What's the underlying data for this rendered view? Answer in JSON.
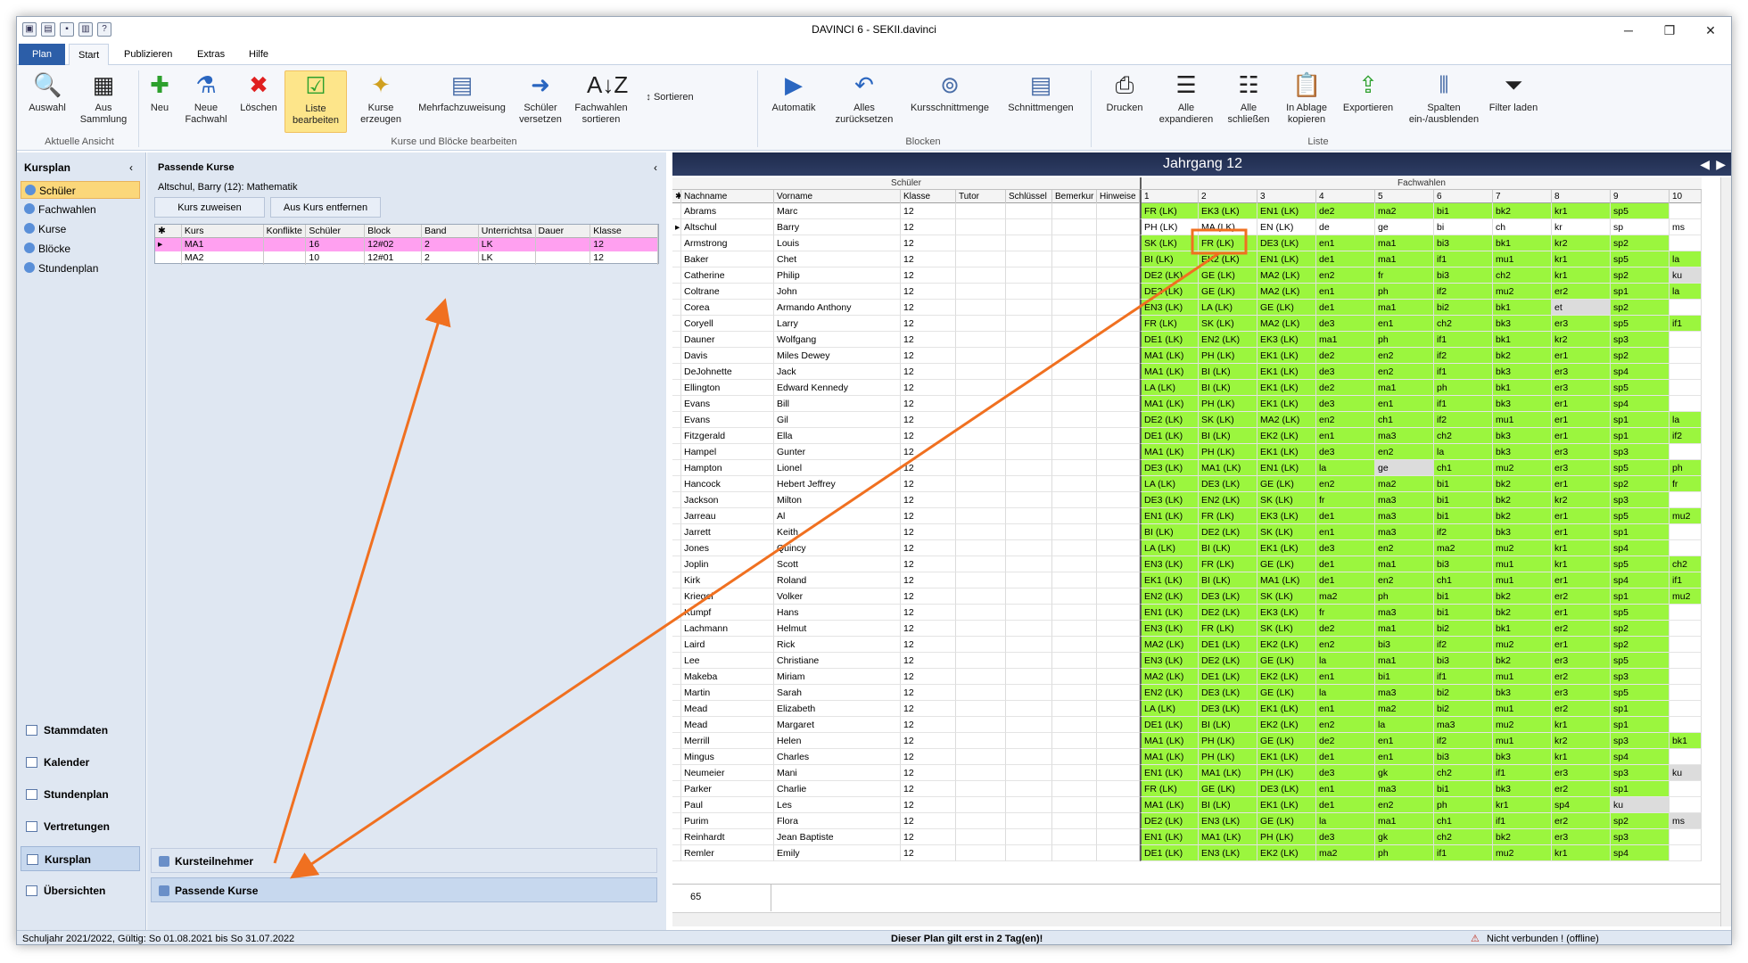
{
  "window": {
    "title": "DAVINCI 6 - SEKII.davinci"
  },
  "tabs": {
    "file": "Plan",
    "start": "Start",
    "publish": "Publizieren",
    "extras": "Extras",
    "help": "Hilfe"
  },
  "ribbon": {
    "auswahl": "Auswahl",
    "sammlung": "Aus Sammlung",
    "neu": "Neu",
    "neue_fachwahl": "Neue Fachwahl",
    "loeschen": "Löschen",
    "liste_bearbeiten": "Liste bearbeiten",
    "kurse_erzeugen": "Kurse erzeugen",
    "mehrfachzuweisung": "Mehrfachzuweisung",
    "schueler_versetzen": "Schüler versetzen",
    "fachwahlen_sortieren": "Fachwahlen sortieren",
    "sortieren": "Sortieren",
    "automatik": "Automatik",
    "alles_zuruecksetzen": "Alles zurücksetzen",
    "kursschnittmenge": "Kursschnittmenge",
    "schnittmengen": "Schnittmengen",
    "drucken": "Drucken",
    "alle_expandieren": "Alle expandieren",
    "alle_schliessen": "Alle schließen",
    "in_ablage": "In Ablage kopieren",
    "exportieren": "Exportieren",
    "spalten": "Spalten ein-/ausblenden",
    "filter_laden": "Filter laden",
    "grp_ansicht": "Aktuelle Ansicht",
    "grp_kurse": "Kurse und Blöcke bearbeiten",
    "grp_blocken": "Blocken",
    "grp_liste": "Liste"
  },
  "leftnav": {
    "header": "Kursplan",
    "items": [
      "Schüler",
      "Fachwahlen",
      "Kurse",
      "Blöcke",
      "Stundenplan"
    ],
    "big": [
      "Stammdaten",
      "Kalender",
      "Stundenplan",
      "Vertretungen",
      "Kursplan",
      "Übersichten"
    ]
  },
  "panel": {
    "header": "Passende Kurse",
    "subtitle": "Altschul, Barry (12): Mathematik",
    "btn_assign": "Kurs zuweisen",
    "btn_remove": "Aus Kurs entfernen",
    "columns": [
      "Kurs",
      "Konflikte",
      "Schüler",
      "Block",
      "Band",
      "Unterrichtsa",
      "Dauer",
      "Klasse"
    ],
    "rows": [
      [
        "MA1",
        "",
        "16",
        "12#02",
        "2",
        "LK",
        "",
        "12"
      ],
      [
        "MA2",
        "",
        "10",
        "12#01",
        "2",
        "LK",
        "",
        "12"
      ]
    ],
    "tab_kursteilnehmer": "Kursteilnehmer",
    "tab_passende": "Passende Kurse"
  },
  "grid": {
    "title": "Jahrgang 12",
    "group_schueler": "Schüler",
    "group_fachwahlen": "Fachwahlen",
    "cols": [
      "Nachname",
      "Vorname",
      "Klasse",
      "Tutor",
      "Schlüssel",
      "Bemerkur",
      "Hinweise"
    ],
    "fcols": [
      "1",
      "2",
      "3",
      "4",
      "5",
      "6",
      "7",
      "8",
      "9",
      "10"
    ],
    "rows": [
      [
        "Abrams",
        "Marc",
        "12",
        "FR (LK)",
        "EK3 (LK)",
        "EN1 (LK)",
        "de2",
        "ma2",
        "bi1",
        "bk2",
        "kr1",
        "sp5",
        ""
      ],
      [
        "Altschul",
        "Barry",
        "12",
        "PH (LK)",
        "MA (LK)",
        "EN (LK)",
        "de",
        "ge",
        "bi",
        "ch",
        "kr",
        "sp",
        "ms"
      ],
      [
        "Armstrong",
        "Louis",
        "12",
        "SK (LK)",
        "FR (LK)",
        "DE3 (LK)",
        "en1",
        "ma1",
        "bi3",
        "bk1",
        "kr2",
        "sp2",
        ""
      ],
      [
        "Baker",
        "Chet",
        "12",
        "BI (LK)",
        "EK2 (LK)",
        "EN1 (LK)",
        "de1",
        "ma1",
        "if1",
        "mu1",
        "kr1",
        "sp5",
        "la"
      ],
      [
        "Catherine",
        "Philip",
        "12",
        "DE2 (LK)",
        "GE (LK)",
        "MA2 (LK)",
        "en2",
        "fr",
        "bi3",
        "ch2",
        "kr1",
        "sp2",
        "ku"
      ],
      [
        "Coltrane",
        "John",
        "12",
        "DE2 (LK)",
        "GE (LK)",
        "MA2 (LK)",
        "en1",
        "ph",
        "if2",
        "mu2",
        "er2",
        "sp1",
        "la"
      ],
      [
        "Corea",
        "Armando Anthony",
        "12",
        "EN3 (LK)",
        "LA (LK)",
        "GE (LK)",
        "de1",
        "ma1",
        "bi2",
        "bk1",
        "et",
        "sp2",
        ""
      ],
      [
        "Coryell",
        "Larry",
        "12",
        "FR (LK)",
        "SK (LK)",
        "MA2 (LK)",
        "de3",
        "en1",
        "ch2",
        "bk3",
        "er3",
        "sp5",
        "if1"
      ],
      [
        "Dauner",
        "Wolfgang",
        "12",
        "DE1 (LK)",
        "EN2 (LK)",
        "EK3 (LK)",
        "ma1",
        "ph",
        "if1",
        "bk1",
        "kr2",
        "sp3",
        ""
      ],
      [
        "Davis",
        "Miles Dewey",
        "12",
        "MA1 (LK)",
        "PH (LK)",
        "EK1 (LK)",
        "de2",
        "en2",
        "if2",
        "bk2",
        "er1",
        "sp2",
        ""
      ],
      [
        "DeJohnette",
        "Jack",
        "12",
        "MA1 (LK)",
        "BI (LK)",
        "EK1 (LK)",
        "de3",
        "en2",
        "if1",
        "bk3",
        "er3",
        "sp4",
        ""
      ],
      [
        "Ellington",
        "Edward Kennedy",
        "12",
        "LA (LK)",
        "BI (LK)",
        "EK1 (LK)",
        "de2",
        "ma1",
        "ph",
        "bk1",
        "er3",
        "sp5",
        ""
      ],
      [
        "Evans",
        "Bill",
        "12",
        "MA1 (LK)",
        "PH (LK)",
        "EK1 (LK)",
        "de3",
        "en1",
        "if1",
        "bk3",
        "er1",
        "sp4",
        ""
      ],
      [
        "Evans",
        "Gil",
        "12",
        "DE2 (LK)",
        "SK (LK)",
        "MA2 (LK)",
        "en2",
        "ch1",
        "if2",
        "mu1",
        "er1",
        "sp1",
        "la"
      ],
      [
        "Fitzgerald",
        "Ella",
        "12",
        "DE1 (LK)",
        "BI (LK)",
        "EK2 (LK)",
        "en1",
        "ma3",
        "ch2",
        "bk3",
        "er1",
        "sp1",
        "if2"
      ],
      [
        "Hampel",
        "Gunter",
        "12",
        "MA1 (LK)",
        "PH (LK)",
        "EK1 (LK)",
        "de3",
        "en2",
        "la",
        "bk3",
        "er3",
        "sp3",
        ""
      ],
      [
        "Hampton",
        "Lionel",
        "12",
        "DE3 (LK)",
        "MA1 (LK)",
        "EN1 (LK)",
        "la",
        "ge",
        "ch1",
        "mu2",
        "er3",
        "sp5",
        "ph"
      ],
      [
        "Hancock",
        "Hebert Jeffrey",
        "12",
        "LA (LK)",
        "DE3 (LK)",
        "GE (LK)",
        "en2",
        "ma2",
        "bi1",
        "bk2",
        "er1",
        "sp2",
        "fr"
      ],
      [
        "Jackson",
        "Milton",
        "12",
        "DE3 (LK)",
        "EN2 (LK)",
        "SK (LK)",
        "fr",
        "ma3",
        "bi1",
        "bk2",
        "kr2",
        "sp3",
        ""
      ],
      [
        "Jarreau",
        "Al",
        "12",
        "EN1 (LK)",
        "FR (LK)",
        "EK3 (LK)",
        "de1",
        "ma3",
        "bi1",
        "bk2",
        "er1",
        "sp5",
        "mu2"
      ],
      [
        "Jarrett",
        "Keith",
        "12",
        "BI (LK)",
        "DE2 (LK)",
        "SK (LK)",
        "en1",
        "ma3",
        "if2",
        "bk3",
        "er1",
        "sp1",
        ""
      ],
      [
        "Jones",
        "Quincy",
        "12",
        "LA (LK)",
        "BI (LK)",
        "EK1 (LK)",
        "de3",
        "en2",
        "ma2",
        "mu2",
        "kr1",
        "sp4",
        ""
      ],
      [
        "Joplin",
        "Scott",
        "12",
        "EN3 (LK)",
        "FR (LK)",
        "GE (LK)",
        "de1",
        "ma1",
        "bi3",
        "mu1",
        "kr1",
        "sp5",
        "ch2"
      ],
      [
        "Kirk",
        "Roland",
        "12",
        "EK1 (LK)",
        "BI (LK)",
        "MA1 (LK)",
        "de1",
        "en2",
        "ch1",
        "mu1",
        "er1",
        "sp4",
        "if1"
      ],
      [
        "Kriegel",
        "Volker",
        "12",
        "EN2 (LK)",
        "DE3 (LK)",
        "SK (LK)",
        "ma2",
        "ph",
        "bi1",
        "bk2",
        "er2",
        "sp1",
        "mu2"
      ],
      [
        "Kumpf",
        "Hans",
        "12",
        "EN1 (LK)",
        "DE2 (LK)",
        "EK3 (LK)",
        "fr",
        "ma3",
        "bi1",
        "bk2",
        "er1",
        "sp5",
        ""
      ],
      [
        "Lachmann",
        "Helmut",
        "12",
        "EN3 (LK)",
        "FR (LK)",
        "SK (LK)",
        "de2",
        "ma1",
        "bi2",
        "bk1",
        "er2",
        "sp2",
        ""
      ],
      [
        "Laird",
        "Rick",
        "12",
        "MA2 (LK)",
        "DE1 (LK)",
        "EK2 (LK)",
        "en2",
        "bi3",
        "if2",
        "mu2",
        "er1",
        "sp2",
        ""
      ],
      [
        "Lee",
        "Christiane",
        "12",
        "EN3 (LK)",
        "DE2 (LK)",
        "GE (LK)",
        "la",
        "ma1",
        "bi3",
        "bk2",
        "er3",
        "sp5",
        ""
      ],
      [
        "Makeba",
        "Miriam",
        "12",
        "MA2 (LK)",
        "DE1 (LK)",
        "EK2 (LK)",
        "en1",
        "bi1",
        "if1",
        "mu1",
        "er2",
        "sp3",
        ""
      ],
      [
        "Martin",
        "Sarah",
        "12",
        "EN2 (LK)",
        "DE3 (LK)",
        "GE (LK)",
        "la",
        "ma3",
        "bi2",
        "bk3",
        "er3",
        "sp5",
        ""
      ],
      [
        "Mead",
        "Elizabeth",
        "12",
        "LA (LK)",
        "DE3 (LK)",
        "EK1 (LK)",
        "en1",
        "ma2",
        "bi2",
        "mu1",
        "er2",
        "sp1",
        ""
      ],
      [
        "Mead",
        "Margaret",
        "12",
        "DE1 (LK)",
        "BI (LK)",
        "EK2 (LK)",
        "en2",
        "la",
        "ma3",
        "mu2",
        "kr1",
        "sp1",
        ""
      ],
      [
        "Merrill",
        "Helen",
        "12",
        "MA1 (LK)",
        "PH (LK)",
        "GE (LK)",
        "de2",
        "en1",
        "if2",
        "mu1",
        "kr2",
        "sp3",
        "bk1"
      ],
      [
        "Mingus",
        "Charles",
        "12",
        "MA1 (LK)",
        "PH (LK)",
        "EK1 (LK)",
        "de1",
        "en1",
        "bi3",
        "bk3",
        "kr1",
        "sp4",
        ""
      ],
      [
        "Neumeier",
        "Mani",
        "12",
        "EN1 (LK)",
        "MA1 (LK)",
        "PH (LK)",
        "de3",
        "gk",
        "ch2",
        "if1",
        "er3",
        "sp3",
        "ku"
      ],
      [
        "Parker",
        "Charlie",
        "12",
        "FR (LK)",
        "GE (LK)",
        "DE3 (LK)",
        "en1",
        "ma3",
        "bi1",
        "bk3",
        "er2",
        "sp1",
        ""
      ],
      [
        "Paul",
        "Les",
        "12",
        "MA1 (LK)",
        "BI (LK)",
        "EK1 (LK)",
        "de1",
        "en2",
        "ph",
        "kr1",
        "sp4",
        "ku",
        ""
      ],
      [
        "Purim",
        "Flora",
        "12",
        "DE2 (LK)",
        "EN3 (LK)",
        "GE (LK)",
        "la",
        "ma1",
        "ch1",
        "if1",
        "er2",
        "sp2",
        "ms"
      ],
      [
        "Reinhardt",
        "Jean Baptiste",
        "12",
        "EN1 (LK)",
        "MA1 (LK)",
        "PH (LK)",
        "de3",
        "gk",
        "ch2",
        "bk2",
        "er3",
        "sp3",
        ""
      ],
      [
        "Remler",
        "Emily",
        "12",
        "DE1 (LK)",
        "EN3 (LK)",
        "EK2 (LK)",
        "ma2",
        "ph",
        "if1",
        "mu2",
        "kr1",
        "sp4",
        ""
      ]
    ],
    "count": "65"
  },
  "status": {
    "left": "Schuljahr 2021/2022, Gültig: So 01.08.2021 bis So 31.07.2022",
    "center": "Dieser Plan gilt erst in 2 Tag(en)!",
    "right": "Nicht verbunden ! (offline)"
  },
  "colors": {
    "green": "#9bf63e",
    "pink": "#ffa0f0",
    "arrow": "#f07020",
    "highlight": "#f07020"
  }
}
